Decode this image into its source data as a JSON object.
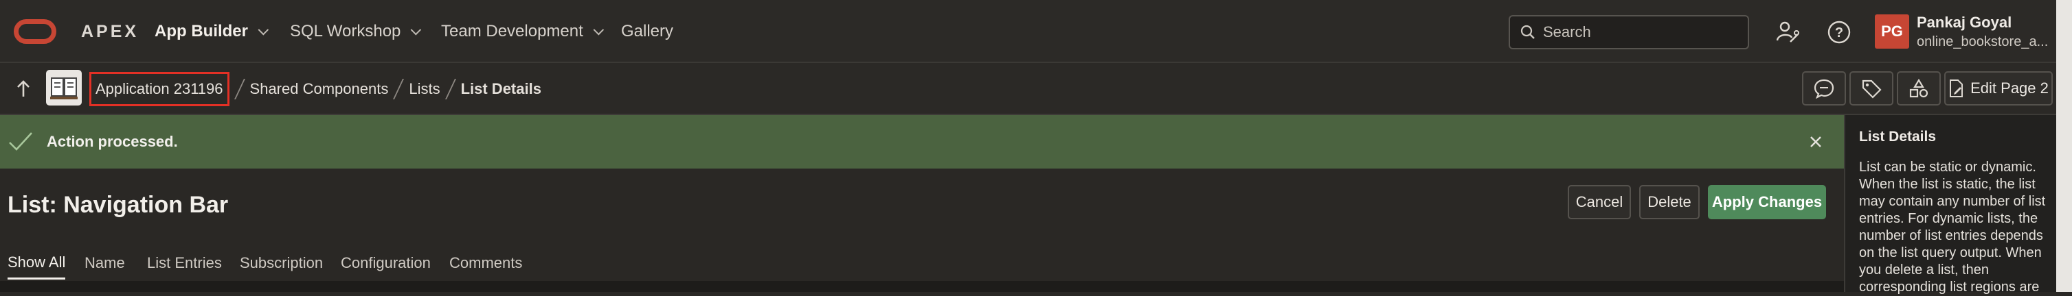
{
  "header": {
    "brand": "APEX",
    "nav": [
      {
        "label": "App Builder"
      },
      {
        "label": "SQL Workshop"
      },
      {
        "label": "Team Development"
      },
      {
        "label": "Gallery"
      }
    ],
    "search_placeholder": "Search",
    "user": {
      "initials": "PG",
      "name": "Pankaj Goyal",
      "workspace": "online_bookstore_a..."
    }
  },
  "breadcrumb": {
    "items": [
      "Application 231196",
      "Shared Components",
      "Lists",
      "List Details"
    ],
    "edit_page_label": "Edit Page 2"
  },
  "alert": {
    "message": "Action processed."
  },
  "page": {
    "title": "List: Navigation Bar",
    "buttons": {
      "cancel": "Cancel",
      "delete": "Delete",
      "apply": "Apply Changes"
    },
    "tabs": [
      "Show All",
      "Name",
      "List Entries",
      "Subscription",
      "Configuration",
      "Comments"
    ]
  },
  "help_panel": {
    "title": "List Details",
    "text": "List can be static or dynamic. When the list is static, the list may contain any number of list entries. For dynamic lists, the number of list entries depends on the list query output. When you delete a list, then corresponding list regions are"
  },
  "colors": {
    "brand_red": "#c74634",
    "success_green": "#4b6340",
    "primary_button": "#4f8a5b",
    "highlight_box": "#e33025"
  }
}
